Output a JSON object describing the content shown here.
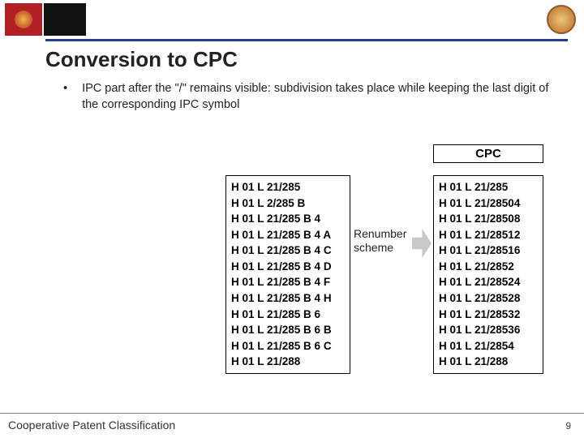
{
  "title": "Conversion to CPC",
  "bullet": "IPC part after the \"/\" remains visible: subdivision takes place while keeping the last digit of the corresponding IPC symbol",
  "cpc_header": "CPC",
  "arrow_line1": "Renumber",
  "arrow_line2": "scheme",
  "left_codes": [
    "H 01 L 21/285",
    "H 01 L 2/285 B",
    "H 01 L 21/285 B 4",
    "H 01 L 21/285 B 4 A",
    "H 01 L 21/285 B 4 C",
    "H 01 L 21/285 B 4 D",
    "H 01 L 21/285 B 4 F",
    "H 01 L 21/285 B 4 H",
    "H 01 L 21/285 B 6",
    "H 01 L 21/285 B 6 B",
    "H 01 L 21/285 B 6 C",
    "H 01 L 21/288"
  ],
  "right_codes": [
    "H 01 L 21/285",
    "H 01 L 21/28504",
    "H 01 L 21/28508",
    "H 01 L 21/28512",
    "H 01 L 21/28516",
    "H 01 L 21/2852",
    "H 01 L 21/28524",
    "H 01 L 21/28528",
    "H 01 L 21/28532",
    "H 01 L 21/28536",
    "H 01 L 21/2854",
    "H 01 L 21/288"
  ],
  "footer_text": "Cooperative Patent Classification",
  "page_number": "9"
}
